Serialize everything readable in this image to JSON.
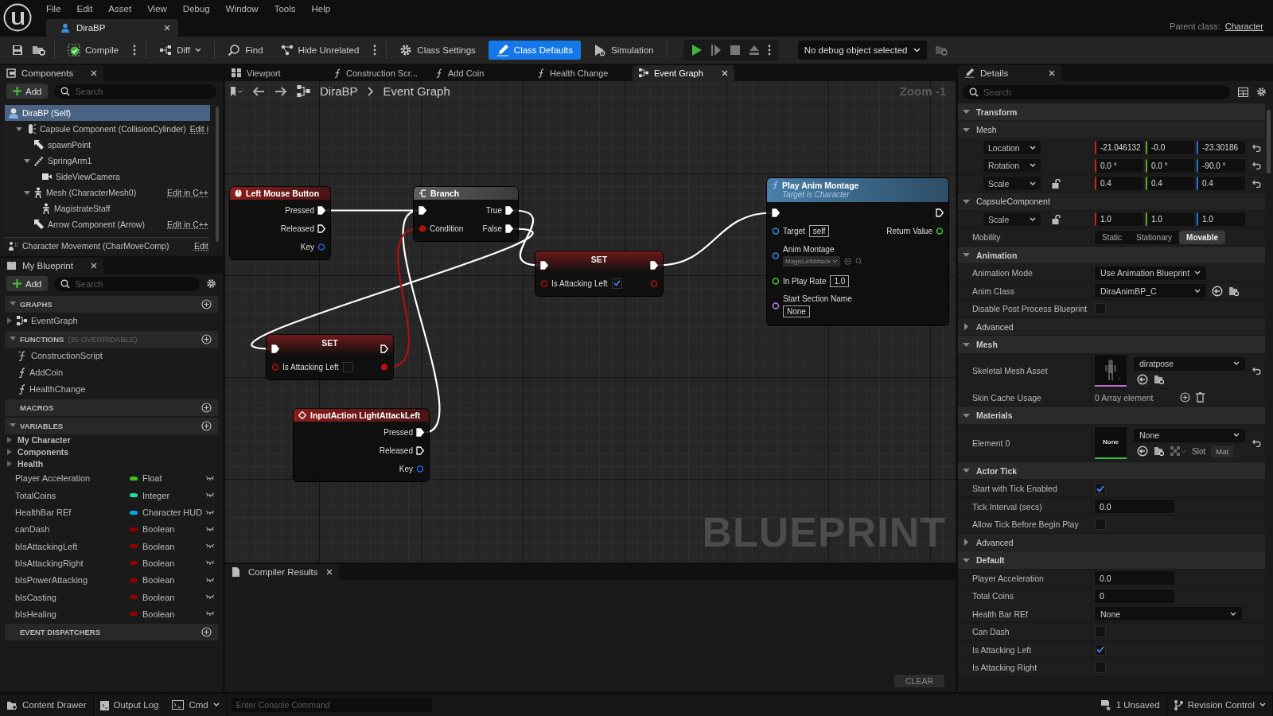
{
  "menu": [
    "File",
    "Edit",
    "Asset",
    "View",
    "Debug",
    "Window",
    "Tools",
    "Help"
  ],
  "document_tab": {
    "title": "DiraBP"
  },
  "parent_class": {
    "label": "Parent class:",
    "value": "Character"
  },
  "toolbar": [
    {
      "kind": "compile",
      "label": "Compile",
      "selected": false
    },
    {
      "kind": "diff",
      "label": "Diff",
      "selected": false
    },
    {
      "kind": "find",
      "label": "Find",
      "selected": false
    },
    {
      "kind": "hide",
      "label": "Hide Unrelated",
      "selected": false
    },
    {
      "kind": "settings",
      "label": "Class Settings",
      "selected": false
    },
    {
      "kind": "defaults",
      "label": "Class Defaults",
      "selected": true
    },
    {
      "kind": "simulation",
      "label": "Simulation",
      "selected": false
    }
  ],
  "debug_object": {
    "label": "No debug object selected"
  },
  "components": {
    "title": "Components",
    "add": "Add",
    "search_placeholder": "Search",
    "tree": [
      {
        "label": "DiraBP (Self)",
        "kind": "actor",
        "selected": true,
        "children": [
          {
            "label": "Capsule Component (CollisionCylinder)",
            "kind": "capsule",
            "selected": false,
            "expanded": true,
            "action": "Edit i",
            "children": [
              {
                "label": "spawnPoint",
                "kind": "arrow",
                "selected": false
              },
              {
                "label": "SpringArm1",
                "kind": "spring_arm",
                "selected": false,
                "expanded": true,
                "children": [
                  {
                    "label": "SideViewCamera",
                    "kind": "camera",
                    "selected": false
                  }
                ]
              },
              {
                "label": "Mesh (CharacterMesh0)",
                "kind": "skeleton",
                "selected": false,
                "expanded": true,
                "action": "Edit in C++",
                "children": [
                  {
                    "label": "MagistrateStaff",
                    "kind": "skeleton",
                    "selected": false
                  }
                ]
              },
              {
                "label": "Arrow Component (Arrow)",
                "kind": "arrow",
                "selected": false,
                "action": "Edit in C++"
              }
            ]
          }
        ]
      },
      {
        "label": "Character Movement (CharMoveComp)",
        "kind": "movement",
        "selected": false,
        "action": "Edit"
      }
    ]
  },
  "my_blueprint": {
    "title": "My Blueprint",
    "add": "Add",
    "search_placeholder": "Search",
    "sections": [
      {
        "title": "GRAPHS",
        "expanded": true,
        "items": [
          {
            "label": "EventGraph",
            "kind": "graph"
          }
        ]
      },
      {
        "title": "FUNCTIONS",
        "note": "(35 OVERRIDABLE)",
        "expanded": true,
        "items": [
          {
            "label": "ConstructionScript",
            "kind": "construction"
          },
          {
            "label": "AddCoin",
            "kind": "function"
          },
          {
            "label": "HealthChange",
            "kind": "function"
          }
        ]
      },
      {
        "title": "MACROS",
        "expanded": false
      },
      {
        "title": "VARIABLES",
        "expanded": true,
        "categories": [
          {
            "label": "My Character",
            "expanded": false
          },
          {
            "label": "Components",
            "expanded": false
          },
          {
            "label": "Health",
            "expanded": false
          }
        ],
        "variables": [
          {
            "name": "Player Acceleration",
            "type": "Float",
            "color": "#3ec41c"
          },
          {
            "name": "TotalCoins",
            "type": "Integer",
            "color": "#1fdca8"
          },
          {
            "name": "HealthBar REf",
            "type": "Character HUD",
            "color": "#0aa6ec"
          },
          {
            "name": "canDash",
            "type": "Boolean",
            "color": "#940000"
          },
          {
            "name": "bIsAttackingLeft",
            "type": "Boolean",
            "color": "#940000"
          },
          {
            "name": "bIsAttackingRight",
            "type": "Boolean",
            "color": "#940000"
          },
          {
            "name": "bIsPowerAttacking",
            "type": "Boolean",
            "color": "#940000"
          },
          {
            "name": "bIsCasting",
            "type": "Boolean",
            "color": "#940000"
          },
          {
            "name": "bIsHealing",
            "type": "Boolean",
            "color": "#940000"
          }
        ]
      },
      {
        "title": "EVENT DISPATCHERS",
        "expanded": false
      }
    ]
  },
  "graph_tabs": [
    {
      "label": "Viewport",
      "kind": "viewport",
      "selected": false
    },
    {
      "label": "Construction Scr...",
      "kind": "function",
      "selected": false
    },
    {
      "label": "Add Coin",
      "kind": "function",
      "selected": false
    },
    {
      "label": "Health Change",
      "kind": "function",
      "selected": false
    },
    {
      "label": "Event Graph",
      "kind": "graph",
      "selected": true
    }
  ],
  "graph": {
    "breadcrumb": [
      "DiraBP",
      "Event Graph"
    ],
    "zoom": "Zoom -1",
    "watermark": "BLUEPRINT",
    "nodes": [
      {
        "kind": "event",
        "title": "Left Mouse Button",
        "rows": [
          {
            "right": {
              "kind": "exec",
              "label": "Pressed",
              "connected": true
            }
          },
          {
            "right": {
              "kind": "exec",
              "label": "Released",
              "connected": false
            }
          },
          {
            "right": {
              "kind": "struct",
              "label": "Key",
              "connected": false
            }
          }
        ]
      },
      {
        "kind": "branch",
        "title": "Branch",
        "rows": [
          {
            "left": {
              "kind": "exec",
              "connected": true
            },
            "right": {
              "kind": "exec",
              "label": "True",
              "connected": true
            }
          },
          {
            "left": {
              "kind": "bool",
              "label": "Condition",
              "connected": true
            },
            "right": {
              "kind": "exec",
              "label": "False",
              "connected": true
            }
          }
        ]
      },
      {
        "kind": "set",
        "title": "SET",
        "rows": [
          {
            "left": {
              "kind": "exec",
              "connected": true
            },
            "right": {
              "kind": "exec",
              "connected": true
            }
          },
          {
            "left": {
              "kind": "bool",
              "label": "Is Attacking Left",
              "connected": false,
              "checked": true
            },
            "right": {
              "kind": "bool",
              "connected": false
            }
          }
        ]
      },
      {
        "kind": "function",
        "title": "Play Anim Montage",
        "subtitle": "Target is Character",
        "rows": [
          {
            "left": {
              "kind": "exec",
              "connected": true
            },
            "right": {
              "kind": "exec",
              "connected": false
            }
          },
          {
            "left": {
              "kind": "object",
              "label": "Target",
              "connected": false,
              "value": "self"
            },
            "right": {
              "kind": "float",
              "label": "Return Value",
              "connected": false
            }
          },
          {
            "left": {
              "kind": "object",
              "label": "Anim Montage",
              "connected": false,
              "dropdown": "MagicLeftAttack"
            }
          },
          {
            "left": {
              "kind": "float",
              "label": "In Play Rate",
              "connected": false,
              "value": "1.0"
            }
          },
          {
            "left": {
              "kind": "name",
              "label": "Start Section Name",
              "connected": false,
              "value_below": "None"
            }
          }
        ]
      },
      {
        "kind": "set",
        "title": "SET",
        "rows": [
          {
            "left": {
              "kind": "exec",
              "connected": true
            },
            "right": {
              "kind": "exec",
              "connected": false
            }
          },
          {
            "left": {
              "kind": "bool",
              "label": "Is Attacking Left",
              "connected": false,
              "checked": false
            },
            "right": {
              "kind": "bool",
              "connected": true
            }
          }
        ]
      },
      {
        "kind": "input_action",
        "title": "InputAction LightAttackLeft",
        "rows": [
          {
            "right": {
              "kind": "exec",
              "label": "Pressed",
              "connected": true
            }
          },
          {
            "right": {
              "kind": "exec",
              "label": "Released",
              "connected": false
            }
          },
          {
            "right": {
              "kind": "struct",
              "label": "Key",
              "connected": false
            }
          }
        ]
      }
    ]
  },
  "compiler": {
    "title": "Compiler Results",
    "clear": "CLEAR"
  },
  "details": {
    "title": "Details",
    "search_placeholder": "Search",
    "rows": [
      {
        "kind": "category",
        "label": "Transform",
        "expanded": true
      },
      {
        "kind": "subcategory",
        "label": "Mesh",
        "expanded": true
      },
      {
        "kind": "vector",
        "label": "Location",
        "values": [
          "-21.046132",
          "-0.0",
          "-23.30186"
        ],
        "resettable": true
      },
      {
        "kind": "vector",
        "label": "Rotation",
        "values": [
          "0.0 °",
          "0.0 °",
          "-90.0 °"
        ],
        "resettable": true
      },
      {
        "kind": "vector",
        "label": "Scale",
        "values": [
          "0.4",
          "0.4",
          "0.4"
        ],
        "locked": false,
        "resettable": true
      },
      {
        "kind": "subcategory",
        "label": "CapsuleComponent",
        "expanded": true
      },
      {
        "kind": "vector",
        "label": "Scale",
        "values": [
          "1.0",
          "1.0",
          "1.0"
        ],
        "locked": false,
        "resettable": false
      },
      {
        "kind": "segmented",
        "label": "Mobility",
        "options": [
          {
            "label": "Static",
            "selected": false
          },
          {
            "label": "Stationary",
            "selected": false
          },
          {
            "label": "Movable",
            "selected": true
          }
        ]
      },
      {
        "kind": "category",
        "label": "Animation",
        "expanded": true
      },
      {
        "kind": "dropdown",
        "label": "Animation Mode",
        "value": "Use Animation Blueprint"
      },
      {
        "kind": "class_picker",
        "label": "Anim Class",
        "value": "DiraAnimBP_C"
      },
      {
        "kind": "checkbox",
        "label": "Disable Post Process Blueprint",
        "checked": false
      },
      {
        "kind": "subcategory",
        "label": "Advanced",
        "expanded": false
      },
      {
        "kind": "category",
        "label": "Mesh",
        "expanded": true
      },
      {
        "kind": "asset",
        "label": "Skeletal Mesh Asset",
        "value": "diratpose",
        "resettable": true
      },
      {
        "kind": "array",
        "label": "Skin Cache Usage",
        "value": "0 Array element"
      },
      {
        "kind": "category",
        "label": "Materials",
        "expanded": true
      },
      {
        "kind": "material",
        "label": "Element 0",
        "thumbnail": "None",
        "value": "None",
        "slot_label": "Slot",
        "slot_value": "Mat",
        "resettable": true
      },
      {
        "kind": "category",
        "label": "Actor Tick",
        "expanded": true
      },
      {
        "kind": "checkbox",
        "label": "Start with Tick Enabled",
        "checked": true
      },
      {
        "kind": "number",
        "label": "Tick Interval (secs)",
        "value": "0.0"
      },
      {
        "kind": "checkbox",
        "label": "Allow Tick Before Begin Play",
        "checked": false
      },
      {
        "kind": "subcategory",
        "label": "Advanced",
        "expanded": false
      },
      {
        "kind": "category",
        "label": "Default",
        "expanded": true
      },
      {
        "kind": "number",
        "label": "Player Acceleration",
        "value": "0.0"
      },
      {
        "kind": "number",
        "label": "Total Coins",
        "value": "0"
      },
      {
        "kind": "wide_dropdown",
        "label": "Health Bar REf",
        "value": "None"
      },
      {
        "kind": "checkbox",
        "label": "Can Dash",
        "checked": false
      },
      {
        "kind": "checkbox",
        "label": "Is Attacking Left",
        "checked": true
      },
      {
        "kind": "checkbox",
        "label": "Is Attacking Right",
        "checked": false
      }
    ]
  },
  "status_bar": {
    "content_drawer": "Content Drawer",
    "output_log": "Output Log",
    "cmd": "Cmd",
    "console_placeholder": "Enter Console Command",
    "unsaved": "1 Unsaved",
    "revision_control": "Revision Control"
  }
}
